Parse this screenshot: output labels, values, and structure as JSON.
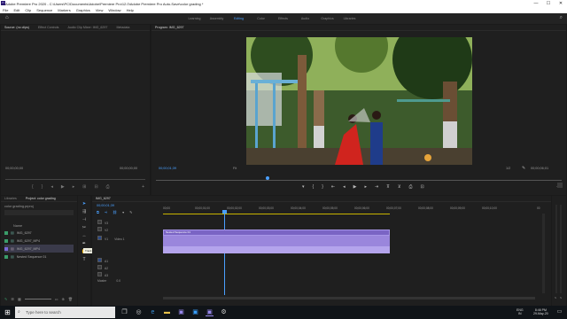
{
  "window": {
    "title": "Adobe Premiere Pro 2020 - C:\\Users\\PC\\Documents\\Adobe\\Premiere Pro\\12.0\\Adobe Premiere Pro Auto-Save\\color grading *",
    "minimize": "—",
    "maximize": "☐",
    "close": "✕"
  },
  "menu": [
    "File",
    "Edit",
    "Clip",
    "Sequence",
    "Markers",
    "Graphics",
    "View",
    "Window",
    "Help"
  ],
  "workspaces": {
    "home_icon": "home-icon",
    "tabs": [
      "Learning",
      "Assembly",
      "Editing",
      "Color",
      "Effects",
      "Audio",
      "Graphics",
      "Libraries"
    ],
    "active": "Editing"
  },
  "source_panel": {
    "tabs": [
      "Source: (no clips)",
      "Effect Controls",
      "Audio Clip Mixer: IMG_6297",
      "Metadata"
    ],
    "tc_left": "00;00;00;00",
    "tc_right": "00;00;00;00"
  },
  "program_panel": {
    "tab": "Program: IMG_6297",
    "tc_current": "00;00;01;39",
    "fit": "Fit",
    "quality": "1/2",
    "tc_duration": "00;00;06;01"
  },
  "project_panel": {
    "tabs": [
      "Libraries",
      "Project: color grading"
    ],
    "filename": "color grading.prproj",
    "name_header": "Name",
    "items": [
      {
        "name": "IMG_6297",
        "color": "#3a9d6a"
      },
      {
        "name": "IMG_6297_MP4",
        "color": "#3a9d6a"
      },
      {
        "name": "IMG_6297_MP4",
        "color": "#7a6ad8"
      },
      {
        "name": "Nested Sequence 01",
        "color": "#3a9d6a"
      }
    ]
  },
  "timeline": {
    "tab": "IMG_6297",
    "tc": "00;00;01;39",
    "ruler": [
      "00;00",
      "00;00;01;00",
      "00;00;02;00",
      "00;00;03;00",
      "00;00;04;00",
      "00;00;05;00",
      "00;00;06;00",
      "00;00;07;00",
      "00;00;08;00",
      "00;00;09;00",
      "00;00;10;00",
      "00"
    ],
    "video_tracks": [
      "V3",
      "V2",
      "V1"
    ],
    "audio_tracks": [
      "A1",
      "A2",
      "A3"
    ],
    "master_label": "Master",
    "master_value": "0.0",
    "clip_label": "Nested Sequence 01",
    "v1_label": "Video 1",
    "tooltip": "Track Select (A)"
  },
  "taskbar": {
    "search_placeholder": "Type here to search",
    "time": "8:46 PM",
    "date": "29-May-20",
    "lang": "ENG",
    "region": "IN"
  }
}
